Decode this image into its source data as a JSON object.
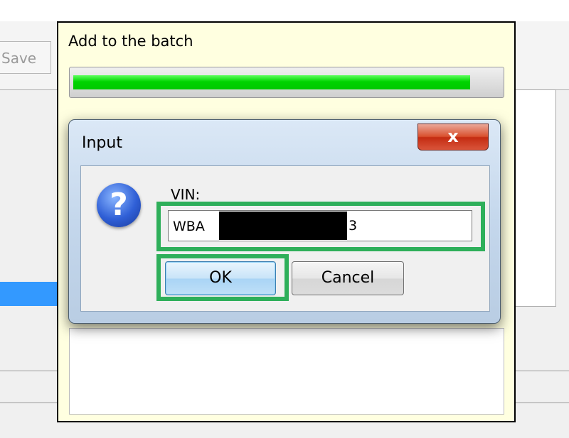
{
  "background_app": {
    "save_label": "Save"
  },
  "batch_dialog": {
    "title": "Add to the batch",
    "progress_fraction": 0.93
  },
  "input_dialog": {
    "title": "Input",
    "close_symbol": "x",
    "icon": "question-icon",
    "vin_label": "VIN:",
    "vin_prefix": "WBA",
    "vin_suffix": "3",
    "ok_label": "OK",
    "cancel_label": "Cancel"
  },
  "colors": {
    "highlight": "#2eaf5a",
    "progress_fill": "#00c800",
    "selection": "#3399ff"
  }
}
